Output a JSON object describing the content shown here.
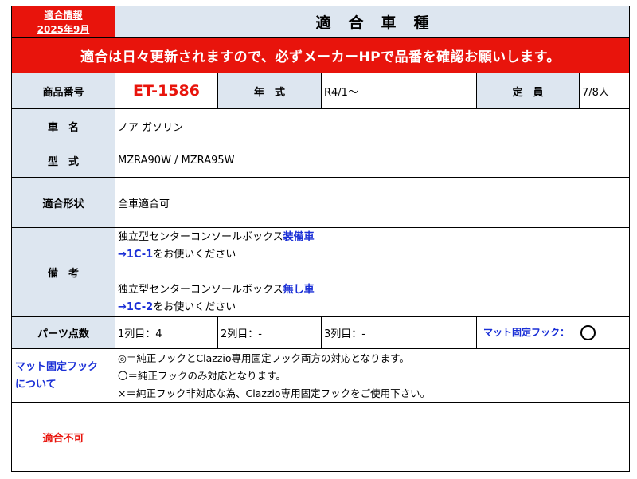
{
  "badge": {
    "line1": "適合情報",
    "line2": "2025年9月"
  },
  "title": "適合車種",
  "notice": "適合は日々更新されますので、必ずメーカーHPで品番を確認お願いします。",
  "row_product": {
    "label": "商品番号",
    "value": "ET-1586",
    "year_label": "年　式",
    "year_value": "R4/1〜",
    "capacity_label": "定　員",
    "capacity_value": "7/8人"
  },
  "row_name": {
    "label": "車　名",
    "value": "ノア ガソリン"
  },
  "row_model": {
    "label": "型　式",
    "value": "MZRA90W / MZRA95W"
  },
  "row_fit": {
    "label": "適合形状",
    "value": "全車適合可"
  },
  "row_notes": {
    "label": "備　考",
    "l1_prefix": "独立型センターコンソールボックス",
    "l1_highlight": "装備車",
    "l2_prefix": "→1C-1",
    "l2_suffix": "をお使いください",
    "l3_prefix": "独立型センターコンソールボックス",
    "l3_highlight": "無し車",
    "l4_prefix": "→1C-2",
    "l4_suffix": "をお使いください"
  },
  "row_parts": {
    "label": "パーツ点数",
    "row1": "1列目：4",
    "row2": "2列目：-",
    "row3": "3列目：-",
    "hook_label": "マット固定フック：",
    "hook_mark": "circle"
  },
  "row_hook": {
    "label_line1": "マット固定フック",
    "label_line2": "について",
    "line1": "◎＝純正フックとClazzio専用固定フック両方の対応となります。",
    "line2": "〇＝純正フックのみ対応となります。",
    "line3": "×＝純正フック非対応な為、Clazzio専用固定フックをご使用下さい。"
  },
  "row_incompatible": {
    "label": "適合不可",
    "value": ""
  },
  "colors": {
    "accent_red": "#e8140c",
    "header_blue": "#dde6f0",
    "link_blue": "#1a2fd6"
  }
}
